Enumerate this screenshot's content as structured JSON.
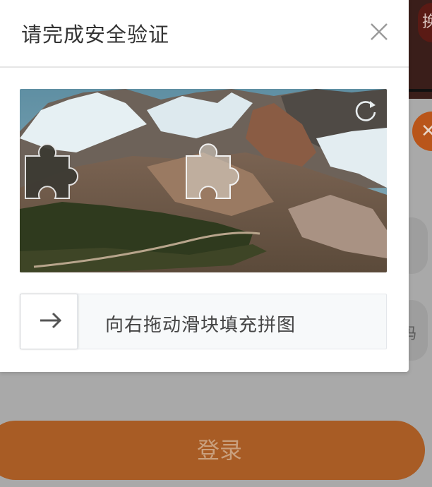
{
  "modal": {
    "title": "请完成安全验证",
    "close_icon": "close-icon",
    "refresh_icon": "refresh-icon"
  },
  "puzzle": {
    "image": "mountain-landscape",
    "piece_icon": "puzzle-piece-icon",
    "target_icon": "puzzle-slot-icon"
  },
  "slider": {
    "instruction": "向右拖动滑块填充拼图",
    "handle_icon": "arrow-right-icon"
  },
  "background": {
    "login_label": "登录",
    "top_badge": "换",
    "code_fragment": "码",
    "accent_color": "#a85c25"
  }
}
